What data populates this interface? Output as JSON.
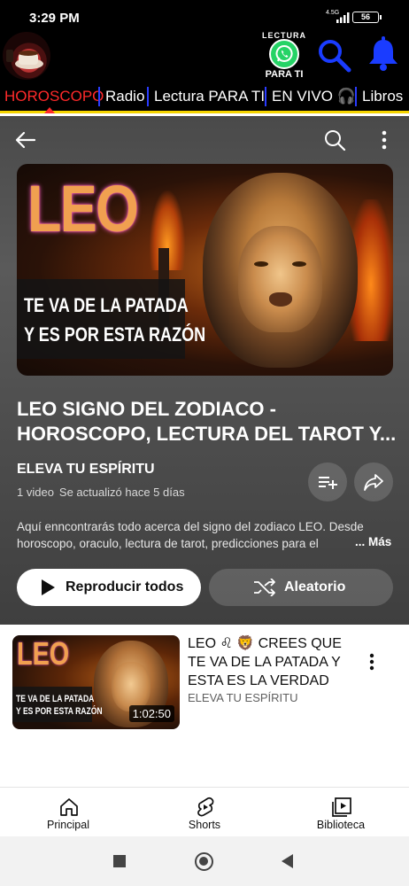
{
  "status_bar": {
    "time": "3:29 PM",
    "network": "4.5G",
    "battery": "56"
  },
  "app_header": {
    "whatsapp_badge_top": "LECTURA",
    "whatsapp_badge_bottom": "PARA TI",
    "icons": [
      "avatar",
      "whatsapp-icon",
      "search-icon",
      "bell-icon"
    ],
    "accent": "#1a3cff"
  },
  "category_tabs": {
    "items": [
      {
        "label": "HOROSCOPO",
        "active": true
      },
      {
        "label": "Radio"
      },
      {
        "label": "Lectura PARA TI"
      },
      {
        "label": "EN VIVO 🎧"
      },
      {
        "label": "Libros"
      }
    ],
    "active_color": "#ff2a2a",
    "underline_color": "#f5d400"
  },
  "playlist": {
    "thumbnail": {
      "big_text": "LEO",
      "caption_line1": "TE VA DE LA PATADA",
      "caption_line2": "Y ES POR ESTA RAZÓN"
    },
    "title_line1": "LEO SIGNO DEL ZODIACO -",
    "title_line2": "HOROSCOPO, LECTURA DEL TAROT Y...",
    "channel": "ELEVA TU ESPÍRITU",
    "video_count": "1 video",
    "updated": "Se actualizó hace 5 días",
    "description_line1": "Aquí enncontrarás todo acerca del signo del zodiaco LEO. Desde",
    "description_line2": "horoscopo, oraculo, lectura de tarot, predicciones para el",
    "more_label": "... Más",
    "play_all_label": "Reproducir todos",
    "shuffle_label": "Aleatorio"
  },
  "videos": [
    {
      "thumb_big": "LEO",
      "thumb_cap1": "TE VA DE LA PATADA",
      "thumb_cap2": "Y ES POR ESTA RAZÓN",
      "duration": "1:02:50",
      "title": "LEO ♌ 🦁 CREES QUE TE VA DE LA PATADA Y ESTA ES LA VERDAD",
      "channel": "ELEVA TU ESPÍRITU"
    }
  ],
  "bottom_nav": {
    "items": [
      {
        "label": "Principal",
        "icon": "home-icon"
      },
      {
        "label": "Shorts",
        "icon": "shorts-icon"
      },
      {
        "label": "Biblioteca",
        "icon": "library-icon"
      }
    ]
  }
}
